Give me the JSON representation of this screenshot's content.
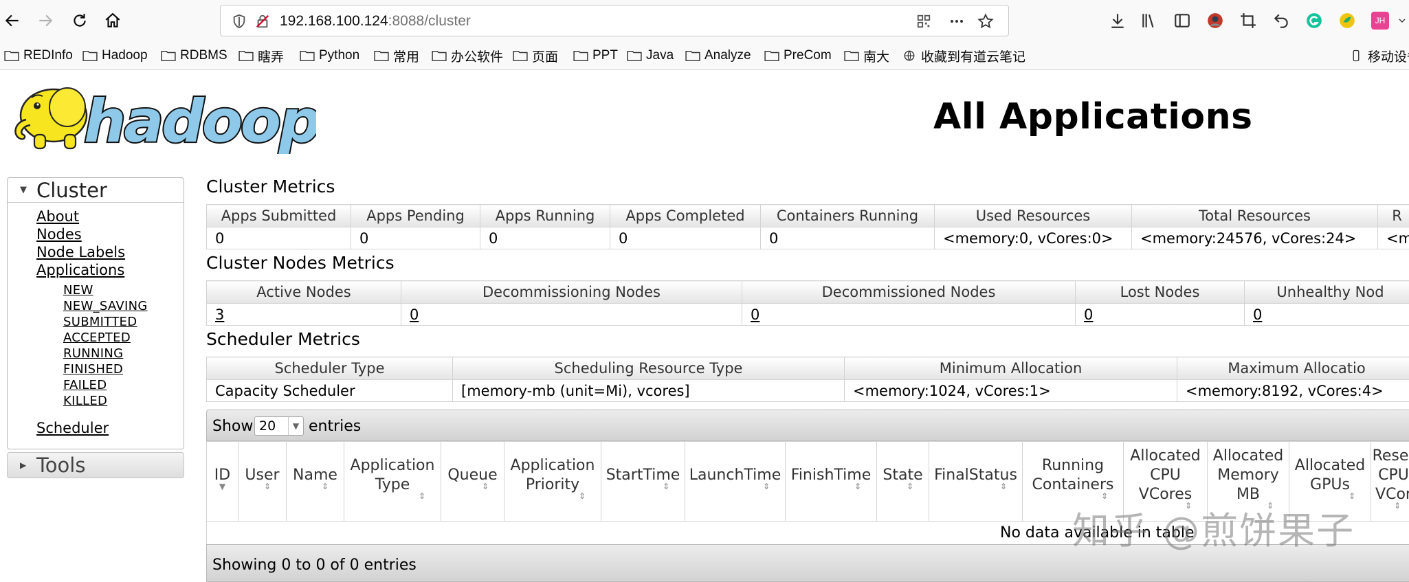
{
  "browser": {
    "url_host": "192.168.100.124",
    "url_rest": ":8088/cluster",
    "bookmarks": [
      "REDInfo",
      "Hadoop",
      "RDBMS",
      "瞎弄",
      "Python",
      "常用",
      "办公软件",
      "页面",
      "PPT",
      "Java",
      "Analyze",
      "PreCom",
      "南大",
      "收藏到有道云笔记",
      "移动设备"
    ],
    "profile_initials": "JH"
  },
  "logo": {
    "text": "hadoop"
  },
  "page": {
    "title": "All Applications"
  },
  "sidebar": {
    "cluster_title": "Cluster",
    "links": [
      "About",
      "Nodes",
      "Node Labels",
      "Applications"
    ],
    "app_states": [
      "NEW",
      "NEW_SAVING",
      "SUBMITTED",
      "ACCEPTED",
      "RUNNING",
      "FINISHED",
      "FAILED",
      "KILLED"
    ],
    "scheduler_link": "Scheduler",
    "tools_title": "Tools"
  },
  "cluster_metrics": {
    "title": "Cluster Metrics",
    "headers": [
      "Apps Submitted",
      "Apps Pending",
      "Apps Running",
      "Apps Completed",
      "Containers Running",
      "Used Resources",
      "Total Resources",
      "R"
    ],
    "values": [
      "0",
      "0",
      "0",
      "0",
      "0",
      "<memory:0, vCores:0>",
      "<memory:24576, vCores:24>",
      "<m"
    ]
  },
  "node_metrics": {
    "title": "Cluster Nodes Metrics",
    "headers": [
      "Active Nodes",
      "Decommissioning Nodes",
      "Decommissioned Nodes",
      "Lost Nodes",
      "Unhealthy Nod"
    ],
    "values": [
      "3",
      "0",
      "0",
      "0",
      "0"
    ]
  },
  "scheduler_metrics": {
    "title": "Scheduler Metrics",
    "headers": [
      "Scheduler Type",
      "Scheduling Resource Type",
      "Minimum Allocation",
      "Maximum Allocatio"
    ],
    "values": [
      "Capacity Scheduler",
      "[memory-mb (unit=Mi), vcores]",
      "<memory:1024, vCores:1>",
      "<memory:8192, vCores:4>"
    ]
  },
  "apps_table": {
    "show_label": "Show",
    "entries_label": "entries",
    "page_length": "20",
    "columns": [
      [
        "ID"
      ],
      [
        "User"
      ],
      [
        "Name"
      ],
      [
        "Application",
        "Type"
      ],
      [
        "Queue"
      ],
      [
        "Application",
        "Priority"
      ],
      [
        "StartTime"
      ],
      [
        "LaunchTime"
      ],
      [
        "FinishTime"
      ],
      [
        "State"
      ],
      [
        "FinalStatus"
      ],
      [
        "Running",
        "Containers"
      ],
      [
        "Allocated",
        "CPU",
        "VCores"
      ],
      [
        "Allocated",
        "Memory",
        "MB"
      ],
      [
        "Allocated",
        "GPUs"
      ],
      [
        "Reser",
        "CPU",
        "VCor"
      ]
    ],
    "empty_message": "No data available in table",
    "info": "Showing 0 to 0 of 0 entries"
  },
  "watermark": "知乎 @煎饼果子"
}
